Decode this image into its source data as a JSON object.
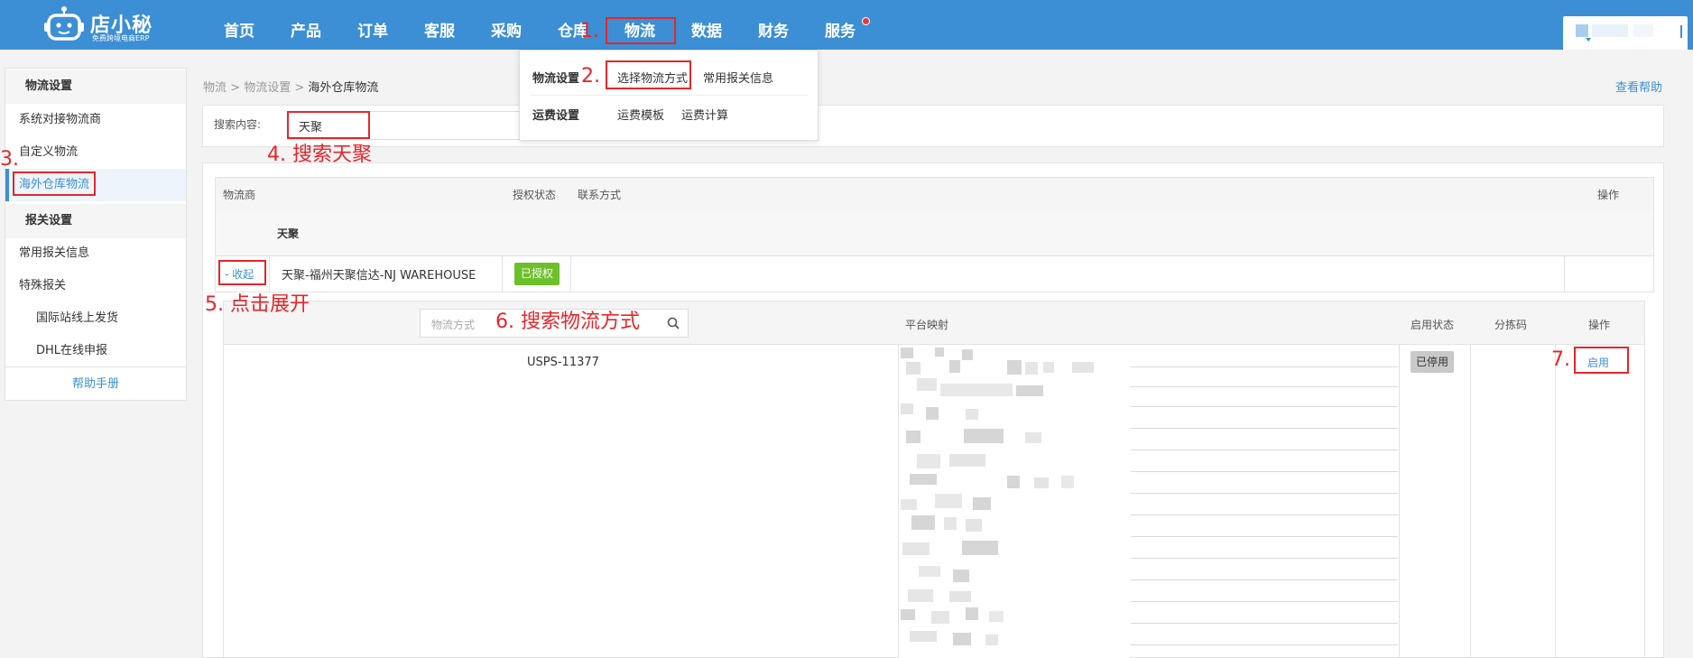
{
  "header": {
    "brand": "店小秘",
    "tagline": "免费跨境电商ERP",
    "nav": [
      "首页",
      "产品",
      "订单",
      "客服",
      "采购",
      "仓库",
      "物流",
      "数据",
      "财务",
      "服务"
    ],
    "active_nav": "物流",
    "colors": {
      "bar": "#3c8fd4",
      "badge": "#e4393c"
    }
  },
  "dropdown": {
    "group1": {
      "title": "物流设置",
      "items": [
        "选择物流方式",
        "常用报关信息"
      ]
    },
    "group2": {
      "title": "运费设置",
      "items": [
        "运费模板",
        "运费计算"
      ]
    }
  },
  "sidebar": {
    "section1": "物流设置",
    "items1": [
      "系统对接物流商",
      "自定义物流",
      "海外仓库物流"
    ],
    "section2": "报关设置",
    "items2": [
      "常用报关信息",
      "特殊报关"
    ],
    "subitems": [
      "国际站线上发货",
      "DHL在线申报"
    ],
    "help": "帮助手册"
  },
  "breadcrumb": {
    "items": [
      "物流",
      "物流设置",
      "海外仓库物流"
    ],
    "sep": ">"
  },
  "help_link": "查看帮助",
  "search": {
    "label": "搜索内容:",
    "value": "天聚"
  },
  "table": {
    "headers": [
      "物流商",
      "授权状态",
      "联系方式",
      "操作"
    ],
    "group_name": "天聚",
    "row": {
      "toggle": "- 收起",
      "provider": "天聚-福州天聚信达-NJ WAREHOUSE",
      "status": "已授权"
    },
    "inner_headers": [
      "平台映射",
      "启用状态",
      "分拣码",
      "操作"
    ],
    "method_search_placeholder": "物流方式",
    "method": {
      "name": "USPS-11377",
      "state": "已停用",
      "action": "启用"
    }
  },
  "annotations": [
    "1.",
    "2.",
    "3.",
    "4. 搜索天聚",
    "5. 点击展开",
    "6. 搜索物流方式",
    "7."
  ]
}
